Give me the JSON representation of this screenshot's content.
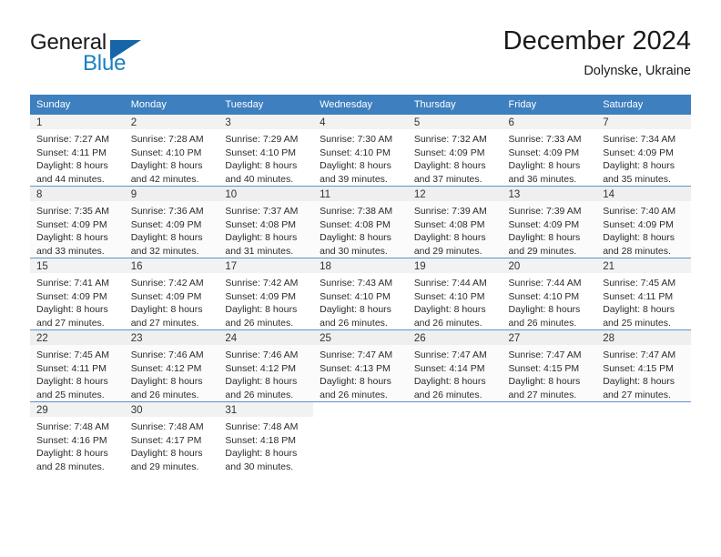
{
  "logo": {
    "word_one": "General",
    "word_two": "Blue",
    "icon": "triangle-icon",
    "primary_color": "#1a7fc1",
    "dark_color": "#1565a8"
  },
  "header": {
    "month_title": "December 2024",
    "location": "Dolynske, Ukraine"
  },
  "calendar": {
    "accent_color": "#3d7fbf",
    "weekday_headers": [
      "Sunday",
      "Monday",
      "Tuesday",
      "Wednesday",
      "Thursday",
      "Friday",
      "Saturday"
    ],
    "weeks": [
      [
        {
          "day": "1",
          "sunrise": "Sunrise: 7:27 AM",
          "sunset": "Sunset: 4:11 PM",
          "daylight_line1": "Daylight: 8 hours",
          "daylight_line2": "and 44 minutes."
        },
        {
          "day": "2",
          "sunrise": "Sunrise: 7:28 AM",
          "sunset": "Sunset: 4:10 PM",
          "daylight_line1": "Daylight: 8 hours",
          "daylight_line2": "and 42 minutes."
        },
        {
          "day": "3",
          "sunrise": "Sunrise: 7:29 AM",
          "sunset": "Sunset: 4:10 PM",
          "daylight_line1": "Daylight: 8 hours",
          "daylight_line2": "and 40 minutes."
        },
        {
          "day": "4",
          "sunrise": "Sunrise: 7:30 AM",
          "sunset": "Sunset: 4:10 PM",
          "daylight_line1": "Daylight: 8 hours",
          "daylight_line2": "and 39 minutes."
        },
        {
          "day": "5",
          "sunrise": "Sunrise: 7:32 AM",
          "sunset": "Sunset: 4:09 PM",
          "daylight_line1": "Daylight: 8 hours",
          "daylight_line2": "and 37 minutes."
        },
        {
          "day": "6",
          "sunrise": "Sunrise: 7:33 AM",
          "sunset": "Sunset: 4:09 PM",
          "daylight_line1": "Daylight: 8 hours",
          "daylight_line2": "and 36 minutes."
        },
        {
          "day": "7",
          "sunrise": "Sunrise: 7:34 AM",
          "sunset": "Sunset: 4:09 PM",
          "daylight_line1": "Daylight: 8 hours",
          "daylight_line2": "and 35 minutes."
        }
      ],
      [
        {
          "day": "8",
          "sunrise": "Sunrise: 7:35 AM",
          "sunset": "Sunset: 4:09 PM",
          "daylight_line1": "Daylight: 8 hours",
          "daylight_line2": "and 33 minutes."
        },
        {
          "day": "9",
          "sunrise": "Sunrise: 7:36 AM",
          "sunset": "Sunset: 4:09 PM",
          "daylight_line1": "Daylight: 8 hours",
          "daylight_line2": "and 32 minutes."
        },
        {
          "day": "10",
          "sunrise": "Sunrise: 7:37 AM",
          "sunset": "Sunset: 4:08 PM",
          "daylight_line1": "Daylight: 8 hours",
          "daylight_line2": "and 31 minutes."
        },
        {
          "day": "11",
          "sunrise": "Sunrise: 7:38 AM",
          "sunset": "Sunset: 4:08 PM",
          "daylight_line1": "Daylight: 8 hours",
          "daylight_line2": "and 30 minutes."
        },
        {
          "day": "12",
          "sunrise": "Sunrise: 7:39 AM",
          "sunset": "Sunset: 4:08 PM",
          "daylight_line1": "Daylight: 8 hours",
          "daylight_line2": "and 29 minutes."
        },
        {
          "day": "13",
          "sunrise": "Sunrise: 7:39 AM",
          "sunset": "Sunset: 4:09 PM",
          "daylight_line1": "Daylight: 8 hours",
          "daylight_line2": "and 29 minutes."
        },
        {
          "day": "14",
          "sunrise": "Sunrise: 7:40 AM",
          "sunset": "Sunset: 4:09 PM",
          "daylight_line1": "Daylight: 8 hours",
          "daylight_line2": "and 28 minutes."
        }
      ],
      [
        {
          "day": "15",
          "sunrise": "Sunrise: 7:41 AM",
          "sunset": "Sunset: 4:09 PM",
          "daylight_line1": "Daylight: 8 hours",
          "daylight_line2": "and 27 minutes."
        },
        {
          "day": "16",
          "sunrise": "Sunrise: 7:42 AM",
          "sunset": "Sunset: 4:09 PM",
          "daylight_line1": "Daylight: 8 hours",
          "daylight_line2": "and 27 minutes."
        },
        {
          "day": "17",
          "sunrise": "Sunrise: 7:42 AM",
          "sunset": "Sunset: 4:09 PM",
          "daylight_line1": "Daylight: 8 hours",
          "daylight_line2": "and 26 minutes."
        },
        {
          "day": "18",
          "sunrise": "Sunrise: 7:43 AM",
          "sunset": "Sunset: 4:10 PM",
          "daylight_line1": "Daylight: 8 hours",
          "daylight_line2": "and 26 minutes."
        },
        {
          "day": "19",
          "sunrise": "Sunrise: 7:44 AM",
          "sunset": "Sunset: 4:10 PM",
          "daylight_line1": "Daylight: 8 hours",
          "daylight_line2": "and 26 minutes."
        },
        {
          "day": "20",
          "sunrise": "Sunrise: 7:44 AM",
          "sunset": "Sunset: 4:10 PM",
          "daylight_line1": "Daylight: 8 hours",
          "daylight_line2": "and 26 minutes."
        },
        {
          "day": "21",
          "sunrise": "Sunrise: 7:45 AM",
          "sunset": "Sunset: 4:11 PM",
          "daylight_line1": "Daylight: 8 hours",
          "daylight_line2": "and 25 minutes."
        }
      ],
      [
        {
          "day": "22",
          "sunrise": "Sunrise: 7:45 AM",
          "sunset": "Sunset: 4:11 PM",
          "daylight_line1": "Daylight: 8 hours",
          "daylight_line2": "and 25 minutes."
        },
        {
          "day": "23",
          "sunrise": "Sunrise: 7:46 AM",
          "sunset": "Sunset: 4:12 PM",
          "daylight_line1": "Daylight: 8 hours",
          "daylight_line2": "and 26 minutes."
        },
        {
          "day": "24",
          "sunrise": "Sunrise: 7:46 AM",
          "sunset": "Sunset: 4:12 PM",
          "daylight_line1": "Daylight: 8 hours",
          "daylight_line2": "and 26 minutes."
        },
        {
          "day": "25",
          "sunrise": "Sunrise: 7:47 AM",
          "sunset": "Sunset: 4:13 PM",
          "daylight_line1": "Daylight: 8 hours",
          "daylight_line2": "and 26 minutes."
        },
        {
          "day": "26",
          "sunrise": "Sunrise: 7:47 AM",
          "sunset": "Sunset: 4:14 PM",
          "daylight_line1": "Daylight: 8 hours",
          "daylight_line2": "and 26 minutes."
        },
        {
          "day": "27",
          "sunrise": "Sunrise: 7:47 AM",
          "sunset": "Sunset: 4:15 PM",
          "daylight_line1": "Daylight: 8 hours",
          "daylight_line2": "and 27 minutes."
        },
        {
          "day": "28",
          "sunrise": "Sunrise: 7:47 AM",
          "sunset": "Sunset: 4:15 PM",
          "daylight_line1": "Daylight: 8 hours",
          "daylight_line2": "and 27 minutes."
        }
      ],
      [
        {
          "day": "29",
          "sunrise": "Sunrise: 7:48 AM",
          "sunset": "Sunset: 4:16 PM",
          "daylight_line1": "Daylight: 8 hours",
          "daylight_line2": "and 28 minutes."
        },
        {
          "day": "30",
          "sunrise": "Sunrise: 7:48 AM",
          "sunset": "Sunset: 4:17 PM",
          "daylight_line1": "Daylight: 8 hours",
          "daylight_line2": "and 29 minutes."
        },
        {
          "day": "31",
          "sunrise": "Sunrise: 7:48 AM",
          "sunset": "Sunset: 4:18 PM",
          "daylight_line1": "Daylight: 8 hours",
          "daylight_line2": "and 30 minutes."
        },
        {
          "day": "",
          "sunrise": "",
          "sunset": "",
          "daylight_line1": "",
          "daylight_line2": ""
        },
        {
          "day": "",
          "sunrise": "",
          "sunset": "",
          "daylight_line1": "",
          "daylight_line2": ""
        },
        {
          "day": "",
          "sunrise": "",
          "sunset": "",
          "daylight_line1": "",
          "daylight_line2": ""
        },
        {
          "day": "",
          "sunrise": "",
          "sunset": "",
          "daylight_line1": "",
          "daylight_line2": ""
        }
      ]
    ]
  }
}
